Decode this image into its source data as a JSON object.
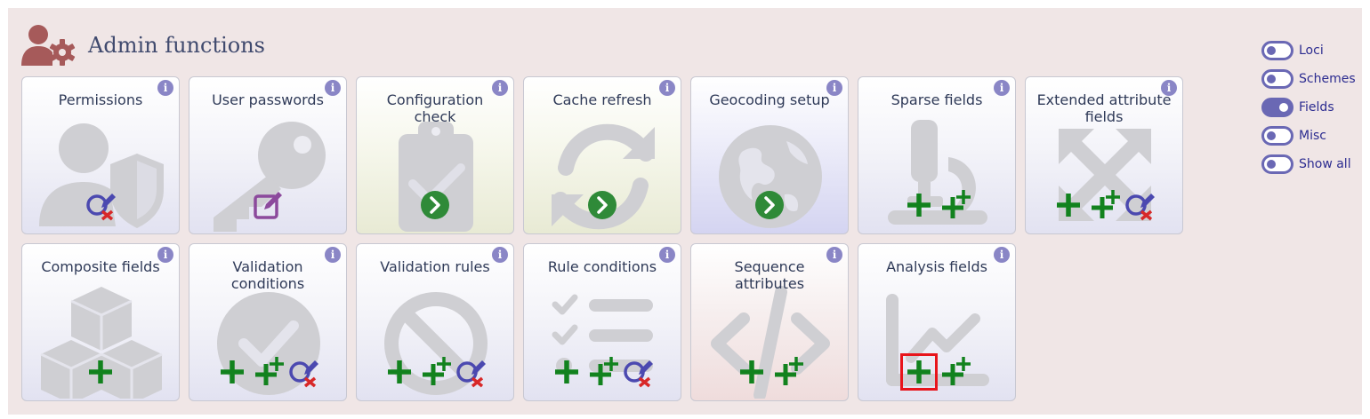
{
  "header": {
    "title": "Admin functions",
    "icon": "user-gear-icon"
  },
  "colors": {
    "add": "#12821e",
    "query": "#4b49b0",
    "delete": "#d82828",
    "edit": "#8c4a9c",
    "go": "#2f8a38",
    "info": "#8a86c6",
    "toggle": "#6a68b4"
  },
  "tiles": [
    {
      "title": "Permissions",
      "icon": "user-shield-icon",
      "actions": [
        "query"
      ]
    },
    {
      "title": "User passwords",
      "icon": "key-icon",
      "actions": [
        "edit"
      ]
    },
    {
      "title": "Configuration check",
      "icon": "clipboard-check-icon",
      "actions": [
        "go"
      ]
    },
    {
      "title": "Cache refresh",
      "icon": "refresh-icon",
      "actions": [
        "go"
      ]
    },
    {
      "title": "Geocoding setup",
      "icon": "globe-icon",
      "actions": [
        "go"
      ]
    },
    {
      "title": "Sparse fields",
      "icon": "microscope-icon",
      "actions": [
        "add",
        "batch-add"
      ]
    },
    {
      "title": "Extended attribute fields",
      "icon": "expand-arrows-icon",
      "actions": [
        "add",
        "batch-add",
        "query"
      ]
    },
    {
      "title": "Composite fields",
      "icon": "cubes-icon",
      "actions": [
        "add"
      ]
    },
    {
      "title": "Validation conditions",
      "icon": "check-circle-icon",
      "actions": [
        "add",
        "batch-add",
        "query"
      ]
    },
    {
      "title": "Validation rules",
      "icon": "ban-icon",
      "actions": [
        "add",
        "batch-add",
        "query"
      ]
    },
    {
      "title": "Rule conditions",
      "icon": "list-check-icon",
      "actions": [
        "add",
        "batch-add",
        "query"
      ]
    },
    {
      "title": "Sequence attributes",
      "icon": "code-icon",
      "actions": [
        "add",
        "batch-add"
      ]
    },
    {
      "title": "Analysis fields",
      "icon": "line-chart-icon",
      "actions": [
        "add",
        "batch-add"
      ],
      "highlighted_action": 0
    }
  ],
  "toggles": [
    {
      "label": "Loci",
      "on": false
    },
    {
      "label": "Schemes",
      "on": false
    },
    {
      "label": "Fields",
      "on": true
    },
    {
      "label": "Misc",
      "on": false
    },
    {
      "label": "Show all",
      "on": false
    }
  ],
  "info_glyph": "i"
}
